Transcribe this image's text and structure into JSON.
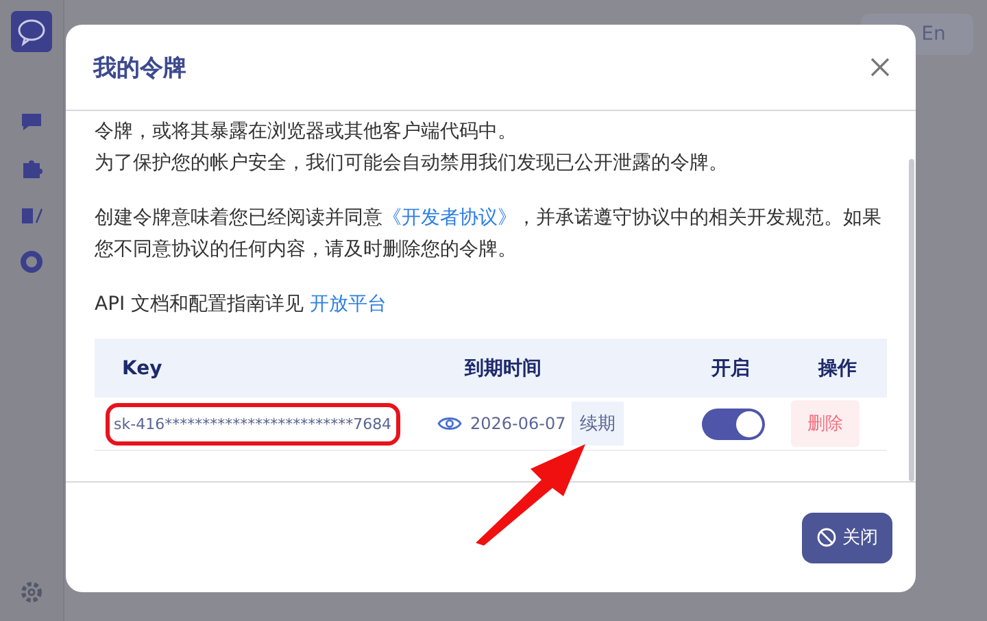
{
  "header": {
    "language_button": "En"
  },
  "modal": {
    "title": "我的令牌",
    "paragraphs": [
      {
        "lines": [
          [
            {
              "kind": "text",
              "text": "令牌，或将其暴露在浏览器或其他客户端代码中。"
            }
          ],
          [
            {
              "kind": "text",
              "text": "为了保护您的帐户安全，我们可能会自动禁用我们发现已公开泄露的令牌。"
            }
          ]
        ]
      },
      {
        "lines": [
          [
            {
              "kind": "text",
              "text": "创建令牌意味着您已经阅读并同意"
            },
            {
              "kind": "link",
              "text": "《开发者协议》"
            },
            {
              "kind": "text",
              "text": "，并承诺遵守协议中的相关开发规范。如果您不同意协议的任何内容，请及时删除您的令牌。"
            }
          ]
        ]
      },
      {
        "lines": [
          [
            {
              "kind": "text",
              "text": "API 文档和配置指南详见 "
            },
            {
              "kind": "link",
              "text": "开放平台"
            }
          ]
        ]
      }
    ],
    "table": {
      "columns": [
        "Key",
        "到期时间",
        "开启",
        "操作"
      ],
      "rows": [
        {
          "key": "sk-416*************************7684",
          "expiry": "2026-06-07",
          "renew": "续期",
          "enabled": true,
          "delete": "删除"
        }
      ]
    },
    "close_button": "关闭"
  }
}
